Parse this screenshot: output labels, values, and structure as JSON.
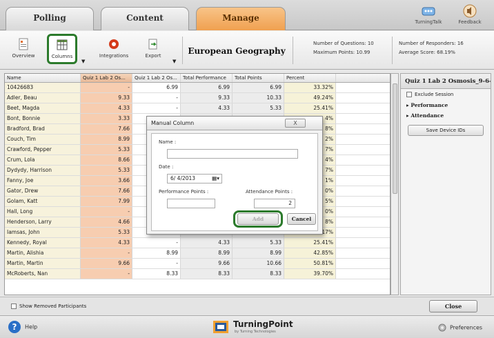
{
  "tabs": [
    {
      "label": "Polling"
    },
    {
      "label": "Content"
    },
    {
      "label": "Manage"
    }
  ],
  "top_right": {
    "turningtalk": "TurningTalk",
    "feedback": "Feedback"
  },
  "ribbon": {
    "overview": "Overview",
    "columns": "Columns",
    "integrations": "Integrations",
    "export": "Export",
    "course_title": "European Geography",
    "num_questions": "Number of Questions: 10",
    "max_points": "Maximum Points: 10.99",
    "num_responders": "Number of Responders: 16",
    "avg_score": "Average Score: 68.19%"
  },
  "grid": {
    "headers": [
      "Name",
      "Quiz 1 Lab 2 Os...",
      "Quiz 1 Lab 2 Os...",
      "Total Performance",
      "Total Points",
      "Percent"
    ],
    "rows": [
      [
        "10426683",
        "-",
        "6.99",
        "6.99",
        "6.99",
        "33.32%"
      ],
      [
        "Adler, Beau",
        "9.33",
        "-",
        "9.33",
        "10.33",
        "49.24%"
      ],
      [
        "Beet, Magda",
        "4.33",
        "-",
        "4.33",
        "5.33",
        "25.41%"
      ],
      [
        "Bont, Bonnie",
        "3.33",
        "",
        "",
        "",
        "4%"
      ],
      [
        "Bradford, Brad",
        "7.66",
        "",
        "",
        "",
        "8%"
      ],
      [
        "Couch, Tim",
        "8.99",
        "",
        "",
        "",
        "2%"
      ],
      [
        "Crawford, Pepper",
        "5.33",
        "",
        "",
        "",
        "7%"
      ],
      [
        "Crum, Lola",
        "8.66",
        "",
        "",
        "",
        "4%"
      ],
      [
        "Dydydy, Harrison",
        "5.33",
        "",
        "",
        "",
        "7%"
      ],
      [
        "Fanny, Joe",
        "3.66",
        "",
        "",
        "",
        "1%"
      ],
      [
        "Gator, Drew",
        "7.66",
        "",
        "",
        "",
        "0%"
      ],
      [
        "Golam, Katt",
        "7.99",
        "",
        "",
        "",
        "5%"
      ],
      [
        "Hall, Long",
        "-",
        "",
        "",
        "",
        "0%"
      ],
      [
        "Henderson, Larry",
        "4.66",
        "",
        "",
        "",
        "8%"
      ],
      [
        "Iamsas, John",
        "5.33",
        "-",
        "5.33",
        "6.33",
        "30.17%"
      ],
      [
        "Kennedy, Royal",
        "4.33",
        "-",
        "4.33",
        "5.33",
        "25.41%"
      ],
      [
        "Martin, Alishia",
        "-",
        "8.99",
        "8.99",
        "8.99",
        "42.85%"
      ],
      [
        "Martin, Martin",
        "9.66",
        "-",
        "9.66",
        "10.66",
        "50.81%"
      ],
      [
        "McRoberts, Nan",
        "-",
        "8.33",
        "8.33",
        "8.33",
        "39.70%"
      ]
    ]
  },
  "right_panel": {
    "title": "Quiz 1 Lab 2 Osmosis_9-6-...",
    "exclude": "Exclude Session",
    "performance": "Performance",
    "attendance": "Attendance",
    "save_ids": "Save Device IDs"
  },
  "bottom": {
    "show_removed": "Show Removed Participants",
    "close": "Close"
  },
  "footer": {
    "help": "Help",
    "brand": "TurningPoint",
    "brand_sub": "by Turning Technologies",
    "preferences": "Preferences"
  },
  "dialog": {
    "title": "Manual Column",
    "close": "X",
    "name_label": "Name :",
    "name_value": "",
    "date_label": "Date :",
    "date_value": "6/ 4/2013",
    "perf_label": "Performance Points :",
    "perf_value": "",
    "att_label": "Attendance Points :",
    "att_value": "2",
    "add": "Add",
    "cancel": "Cancel"
  }
}
